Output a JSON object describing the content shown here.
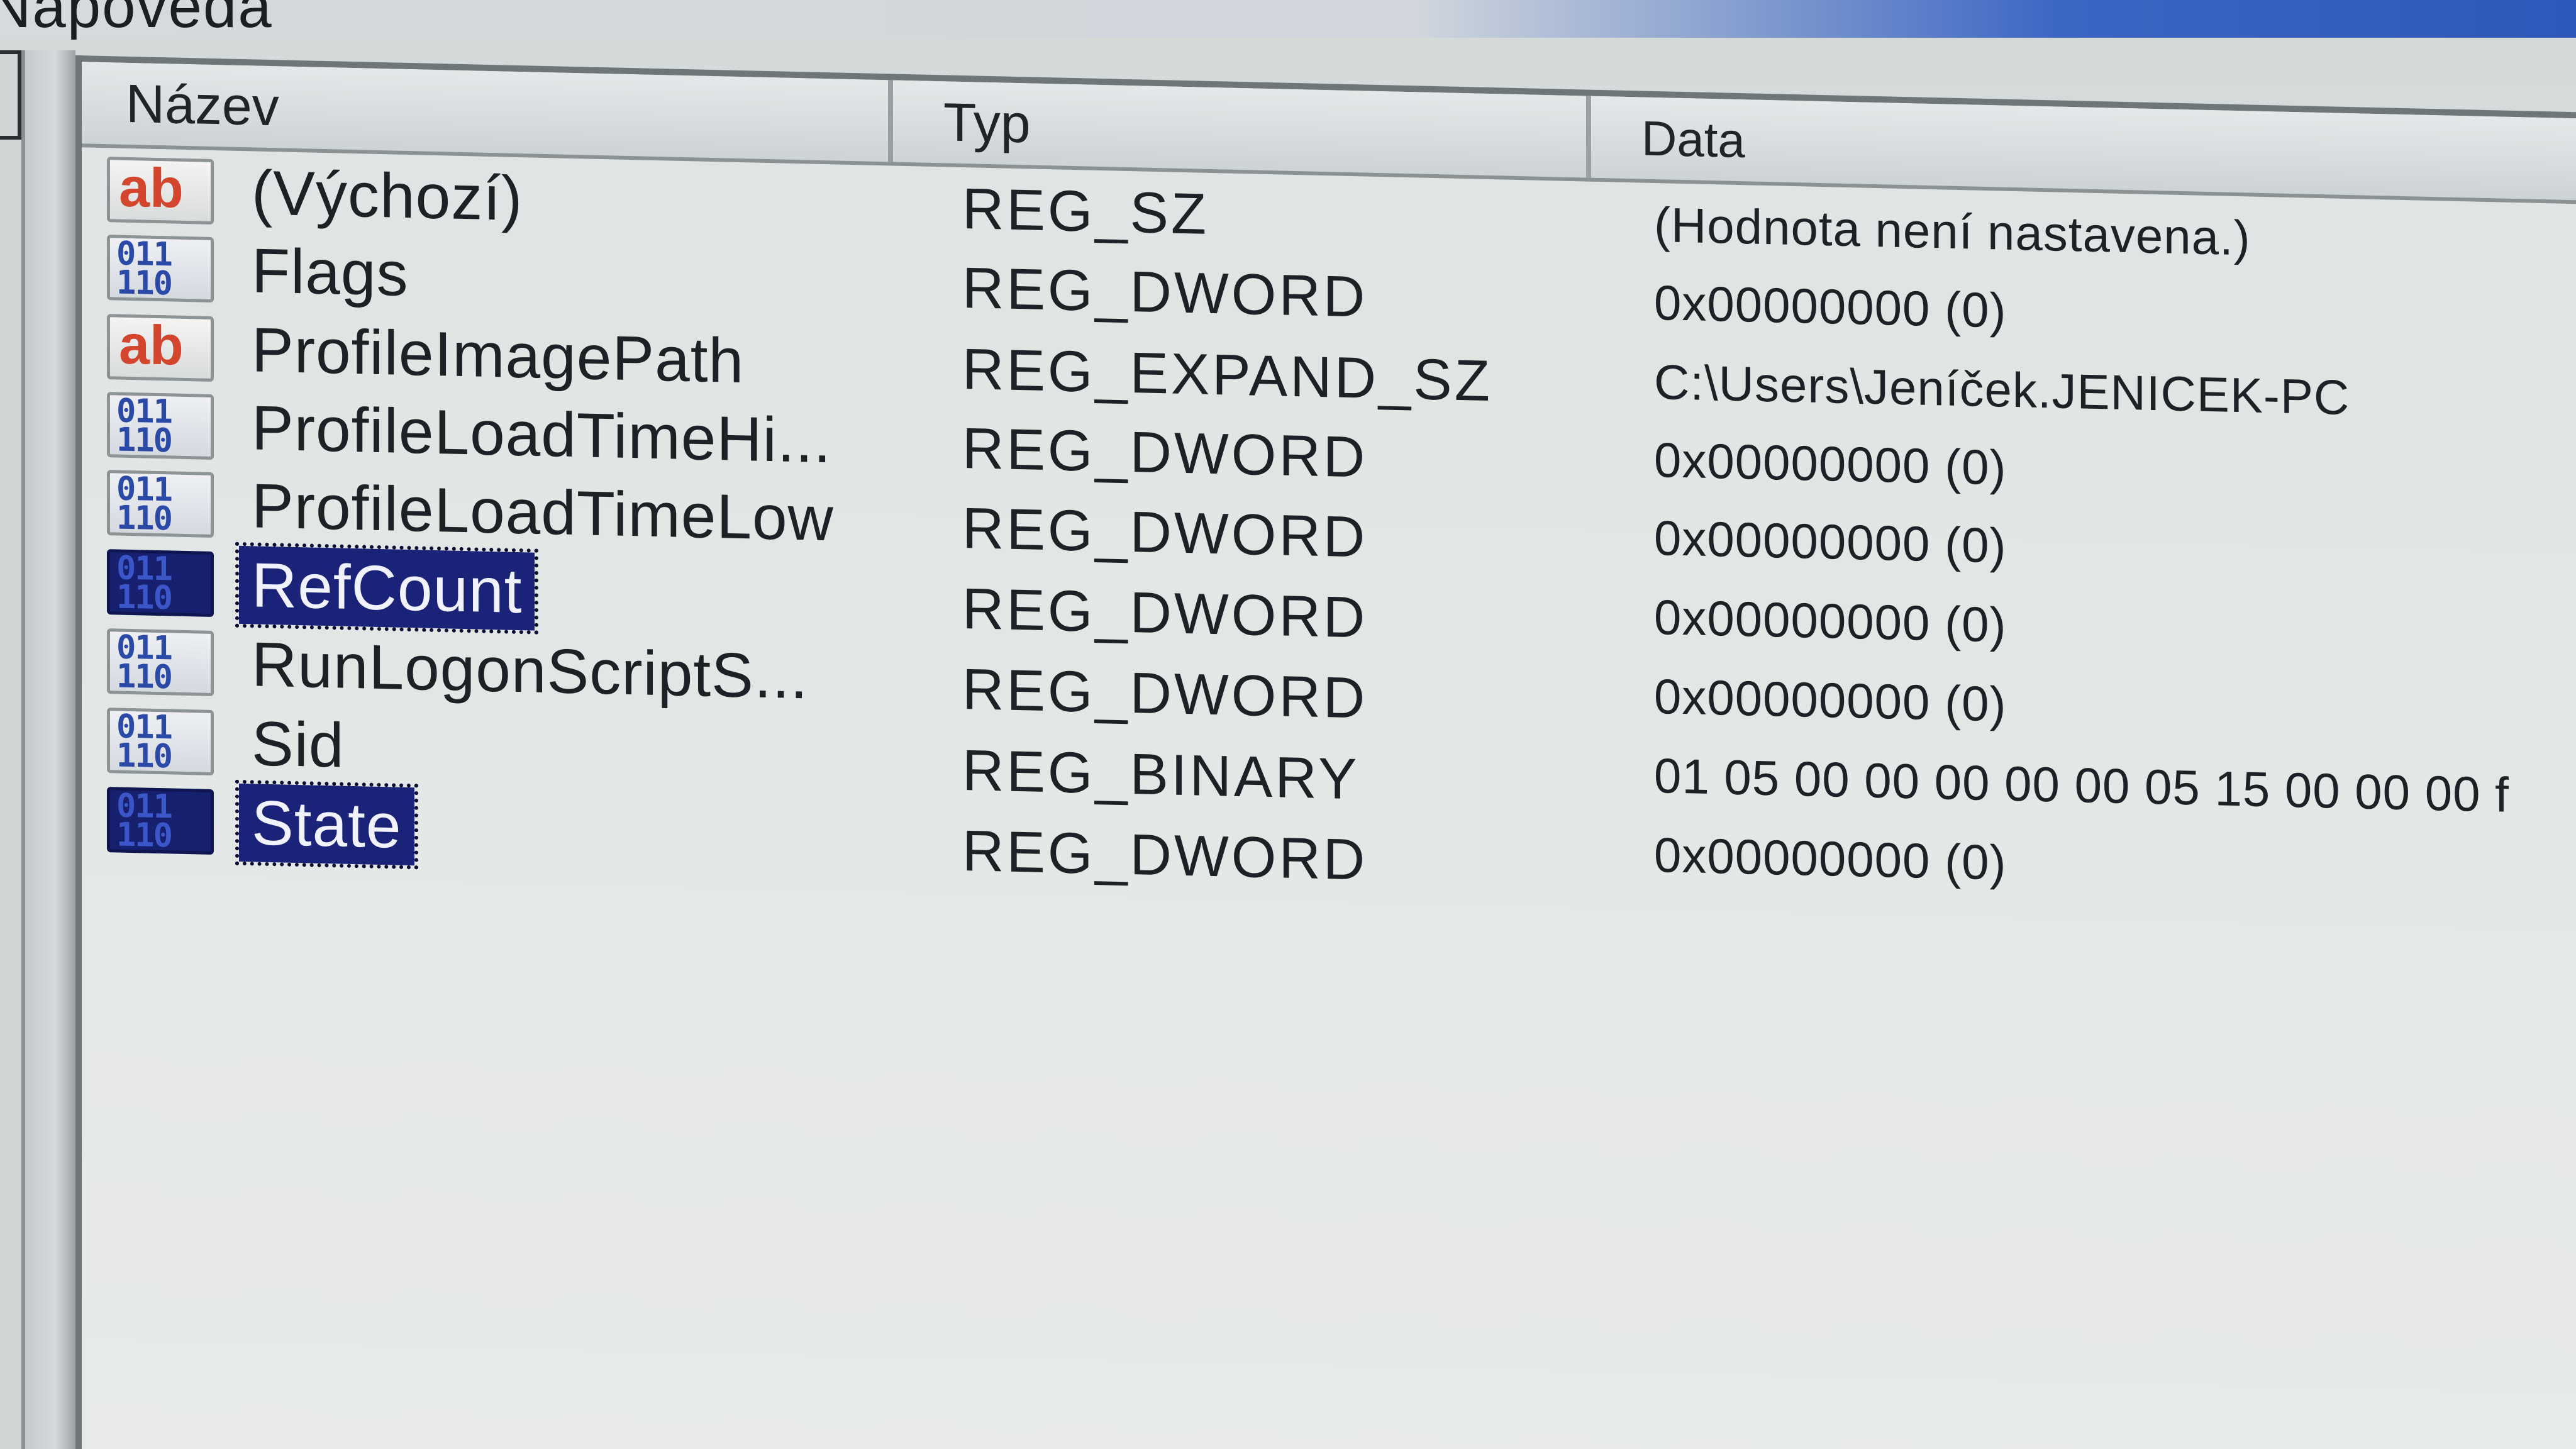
{
  "menubar": {
    "menu_label": "Nápověda"
  },
  "columns": {
    "name": "Název",
    "type": "Typ",
    "data": "Data"
  },
  "rows": [
    {
      "icon": "string-value-icon",
      "name": "(Výchozí)",
      "type": "REG_SZ",
      "data": "(Hodnota není nastavena.)",
      "selected": false
    },
    {
      "icon": "binary-value-icon",
      "name": "Flags",
      "type": "REG_DWORD",
      "data": "0x00000000 (0)",
      "selected": false
    },
    {
      "icon": "string-value-icon",
      "name": "ProfileImagePath",
      "type": "REG_EXPAND_SZ",
      "data": "C:\\Users\\Jeníček.JENICEK-PC",
      "selected": false
    },
    {
      "icon": "binary-value-icon",
      "name": "ProfileLoadTimeHi...",
      "type": "REG_DWORD",
      "data": "0x00000000 (0)",
      "selected": false
    },
    {
      "icon": "binary-value-icon",
      "name": "ProfileLoadTimeLow",
      "type": "REG_DWORD",
      "data": "0x00000000 (0)",
      "selected": false
    },
    {
      "icon": "binary-value-icon",
      "name": "RefCount",
      "type": "REG_DWORD",
      "data": "0x00000000 (0)",
      "selected": true
    },
    {
      "icon": "binary-value-icon",
      "name": "RunLogonScriptS...",
      "type": "REG_DWORD",
      "data": "0x00000000 (0)",
      "selected": false
    },
    {
      "icon": "binary-value-icon",
      "name": "Sid",
      "type": "REG_BINARY",
      "data": "01 05 00 00 00 00 00 05 15 00 00 00 f",
      "selected": false
    },
    {
      "icon": "binary-value-icon",
      "name": "State",
      "type": "REG_DWORD",
      "data": "0x00000000 (0)",
      "selected": true
    }
  ],
  "icon_glyphs": {
    "string": "ab",
    "binary": "011\n110"
  },
  "colors": {
    "selection": "#1b2378",
    "string_icon": "#d4452d",
    "binary_icon": "#2b4aa8"
  }
}
